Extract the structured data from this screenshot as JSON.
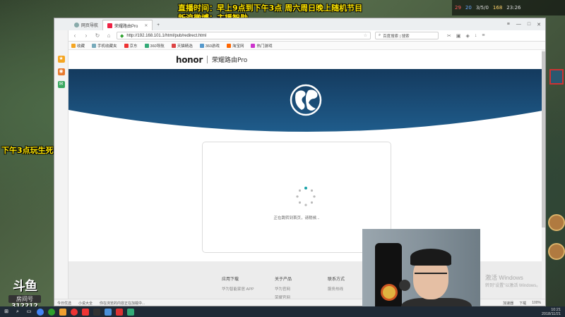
{
  "overlay": {
    "line1": "直播时间：早上9点到下午3点  周六周日晚上随机节目",
    "line2": "新浪微博：主播智勋",
    "side": "下午3点玩生死狙击2"
  },
  "hud": {
    "score_red": "29",
    "score_blue": "20",
    "kda": "3/5/0",
    "cs": "168",
    "time": "23:26",
    "fps": "FPS"
  },
  "douyu": {
    "logo": "斗鱼",
    "room_label": "房间号",
    "room_number": "312212"
  },
  "browser": {
    "tabs": [
      {
        "label": "网页导航",
        "active": false
      },
      {
        "label": "荣耀路由Pro",
        "active": true
      }
    ],
    "window_controls": [
      "≡",
      "—",
      "□",
      "✕"
    ],
    "url": "http://192.168.101.1/html/pub/redirect.html",
    "search_placeholder": "百度搜索 | 搜索",
    "bookmarks": [
      "收藏",
      "手机收藏夹",
      "京东",
      "360导航",
      "天猫精选",
      "360游戏",
      "淘宝网",
      "热门游戏"
    ],
    "page": {
      "brand": "honor",
      "product": "荣耀路由Pro",
      "status_text": "正在跳转到首页，请稍候..."
    },
    "footer": {
      "columns": [
        {
          "heading": "应用下载",
          "links": [
            "华为智能家居 APP"
          ]
        },
        {
          "heading": "关于产品",
          "links": [
            "华为官网",
            "荣耀官网"
          ]
        },
        {
          "heading": "联系方式",
          "links": [
            "服务热线"
          ]
        }
      ],
      "watermark_line1": "激活 Windows",
      "watermark_line2": "转到\"设置\"以激活 Windows。"
    },
    "statusbar": {
      "left_items": [
        "今日优选",
        "小说大全",
        "你在浏览的内容正在加载中..."
      ],
      "right_items": [
        "加速器",
        "下载",
        "100%"
      ]
    }
  },
  "taskbar": {
    "time": "10:21",
    "date": "2018/11/21"
  },
  "colors": {
    "hero_blue": "#1f5c8b",
    "hero_dark": "#143a5e",
    "overlay_yellow": "#ffe600",
    "spinner_accent": "#17a2a8"
  }
}
